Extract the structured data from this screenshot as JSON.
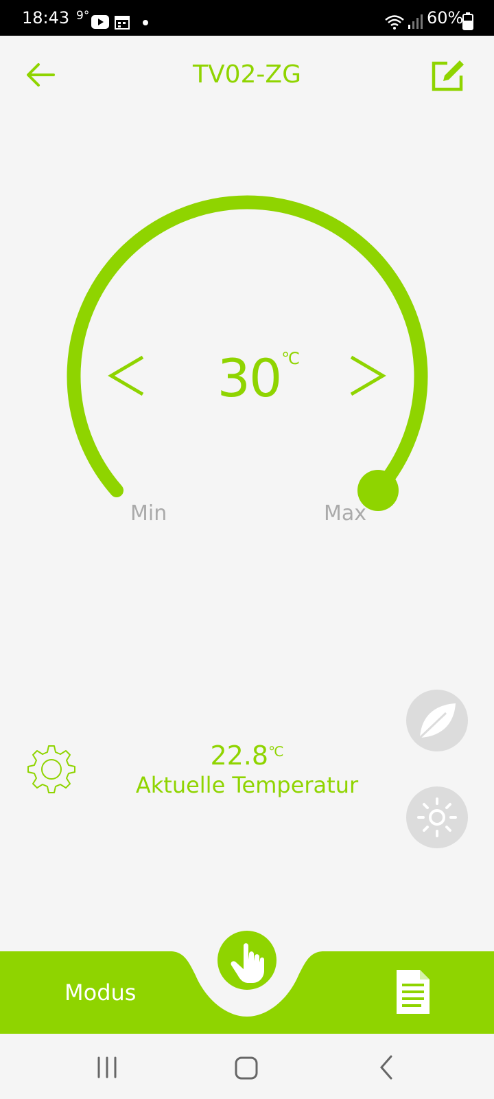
{
  "status_bar": {
    "time": "18:43",
    "outdoor_temp": "9°",
    "battery": "60%"
  },
  "header": {
    "title": "TV02-ZG"
  },
  "thermostat": {
    "setpoint": "30",
    "unit": "℃",
    "min_label": "Min",
    "max_label": "Max",
    "level_fraction": 1.0
  },
  "current": {
    "temperature": "22.8",
    "unit": "℃",
    "label": "Aktuelle Temperatur"
  },
  "bottom_bar": {
    "modus_label": "Modus"
  },
  "colors": {
    "accent": "#8fd400",
    "muted": "#aaaaaa",
    "button_bg": "#dcdcdc"
  },
  "icons": {
    "back": "arrow-left-icon",
    "edit": "edit-icon",
    "settings": "gear-icon",
    "eco": "leaf-icon",
    "comfort": "sun-icon",
    "manual": "hand-icon",
    "log": "document-icon"
  }
}
